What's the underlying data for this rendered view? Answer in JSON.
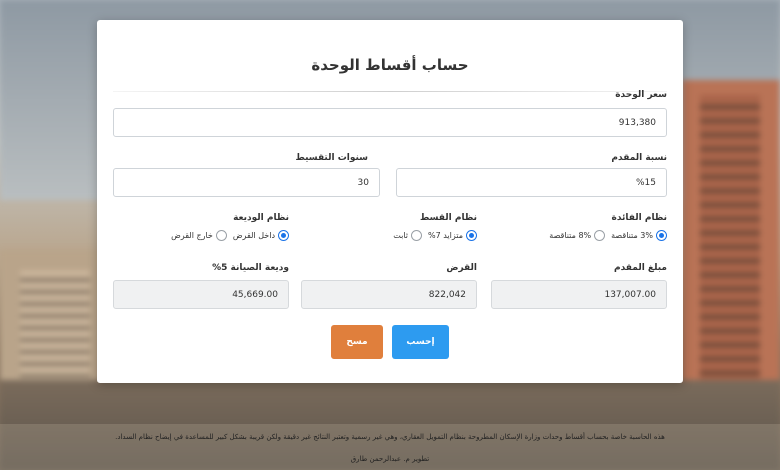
{
  "card": {
    "title": "حساب أقساط الوحدة"
  },
  "fields": {
    "unit_price": {
      "label": "سعر الوحدة",
      "value": "913,380"
    },
    "down_payment_pct": {
      "label": "نسبة المقدم",
      "value": "%15"
    },
    "installment_years": {
      "label": "سنوات التقسيط",
      "value": "30"
    },
    "down_payment_amount": {
      "label": "مبلغ المقدم",
      "value": "137,007.00"
    },
    "loan": {
      "label": "القرض",
      "value": "822,042"
    },
    "maintenance_deposit": {
      "label": "وديعة الصيانة 5%",
      "value": "45,669.00"
    }
  },
  "interest_system": {
    "label": "نظام الفائدة",
    "options": [
      {
        "label": "3% متناقصة",
        "selected": true
      },
      {
        "label": "8% متناقصة",
        "selected": false
      }
    ]
  },
  "installment_system": {
    "label": "نظام القسط",
    "options": [
      {
        "label": "متزايد 7%",
        "selected": true
      },
      {
        "label": "ثابت",
        "selected": false
      }
    ]
  },
  "deposit_system": {
    "label": "نظام الوديعة",
    "options": [
      {
        "label": "داخل القرض",
        "selected": true
      },
      {
        "label": "خارج القرض",
        "selected": false
      }
    ]
  },
  "buttons": {
    "calculate": "إحسب",
    "clear": "مسح"
  },
  "footer": {
    "disclaimer": "هذه الحاسبة خاصة بحساب أقساط وحدات وزارة الإسكان المطروحة بنظام التمويل العقاري، وهي غير رسمية وتعتبر النتائج غير دقيقة ولكن قريبة بشكل كبير للمساعدة في إيضاح نظام السداد.",
    "credit": "تطوير م. عبدالرحمن طارق"
  },
  "colors": {
    "accent_blue": "#2d9bf0",
    "clear_orange": "#e07f3c",
    "radio_blue": "#1a73e8"
  }
}
